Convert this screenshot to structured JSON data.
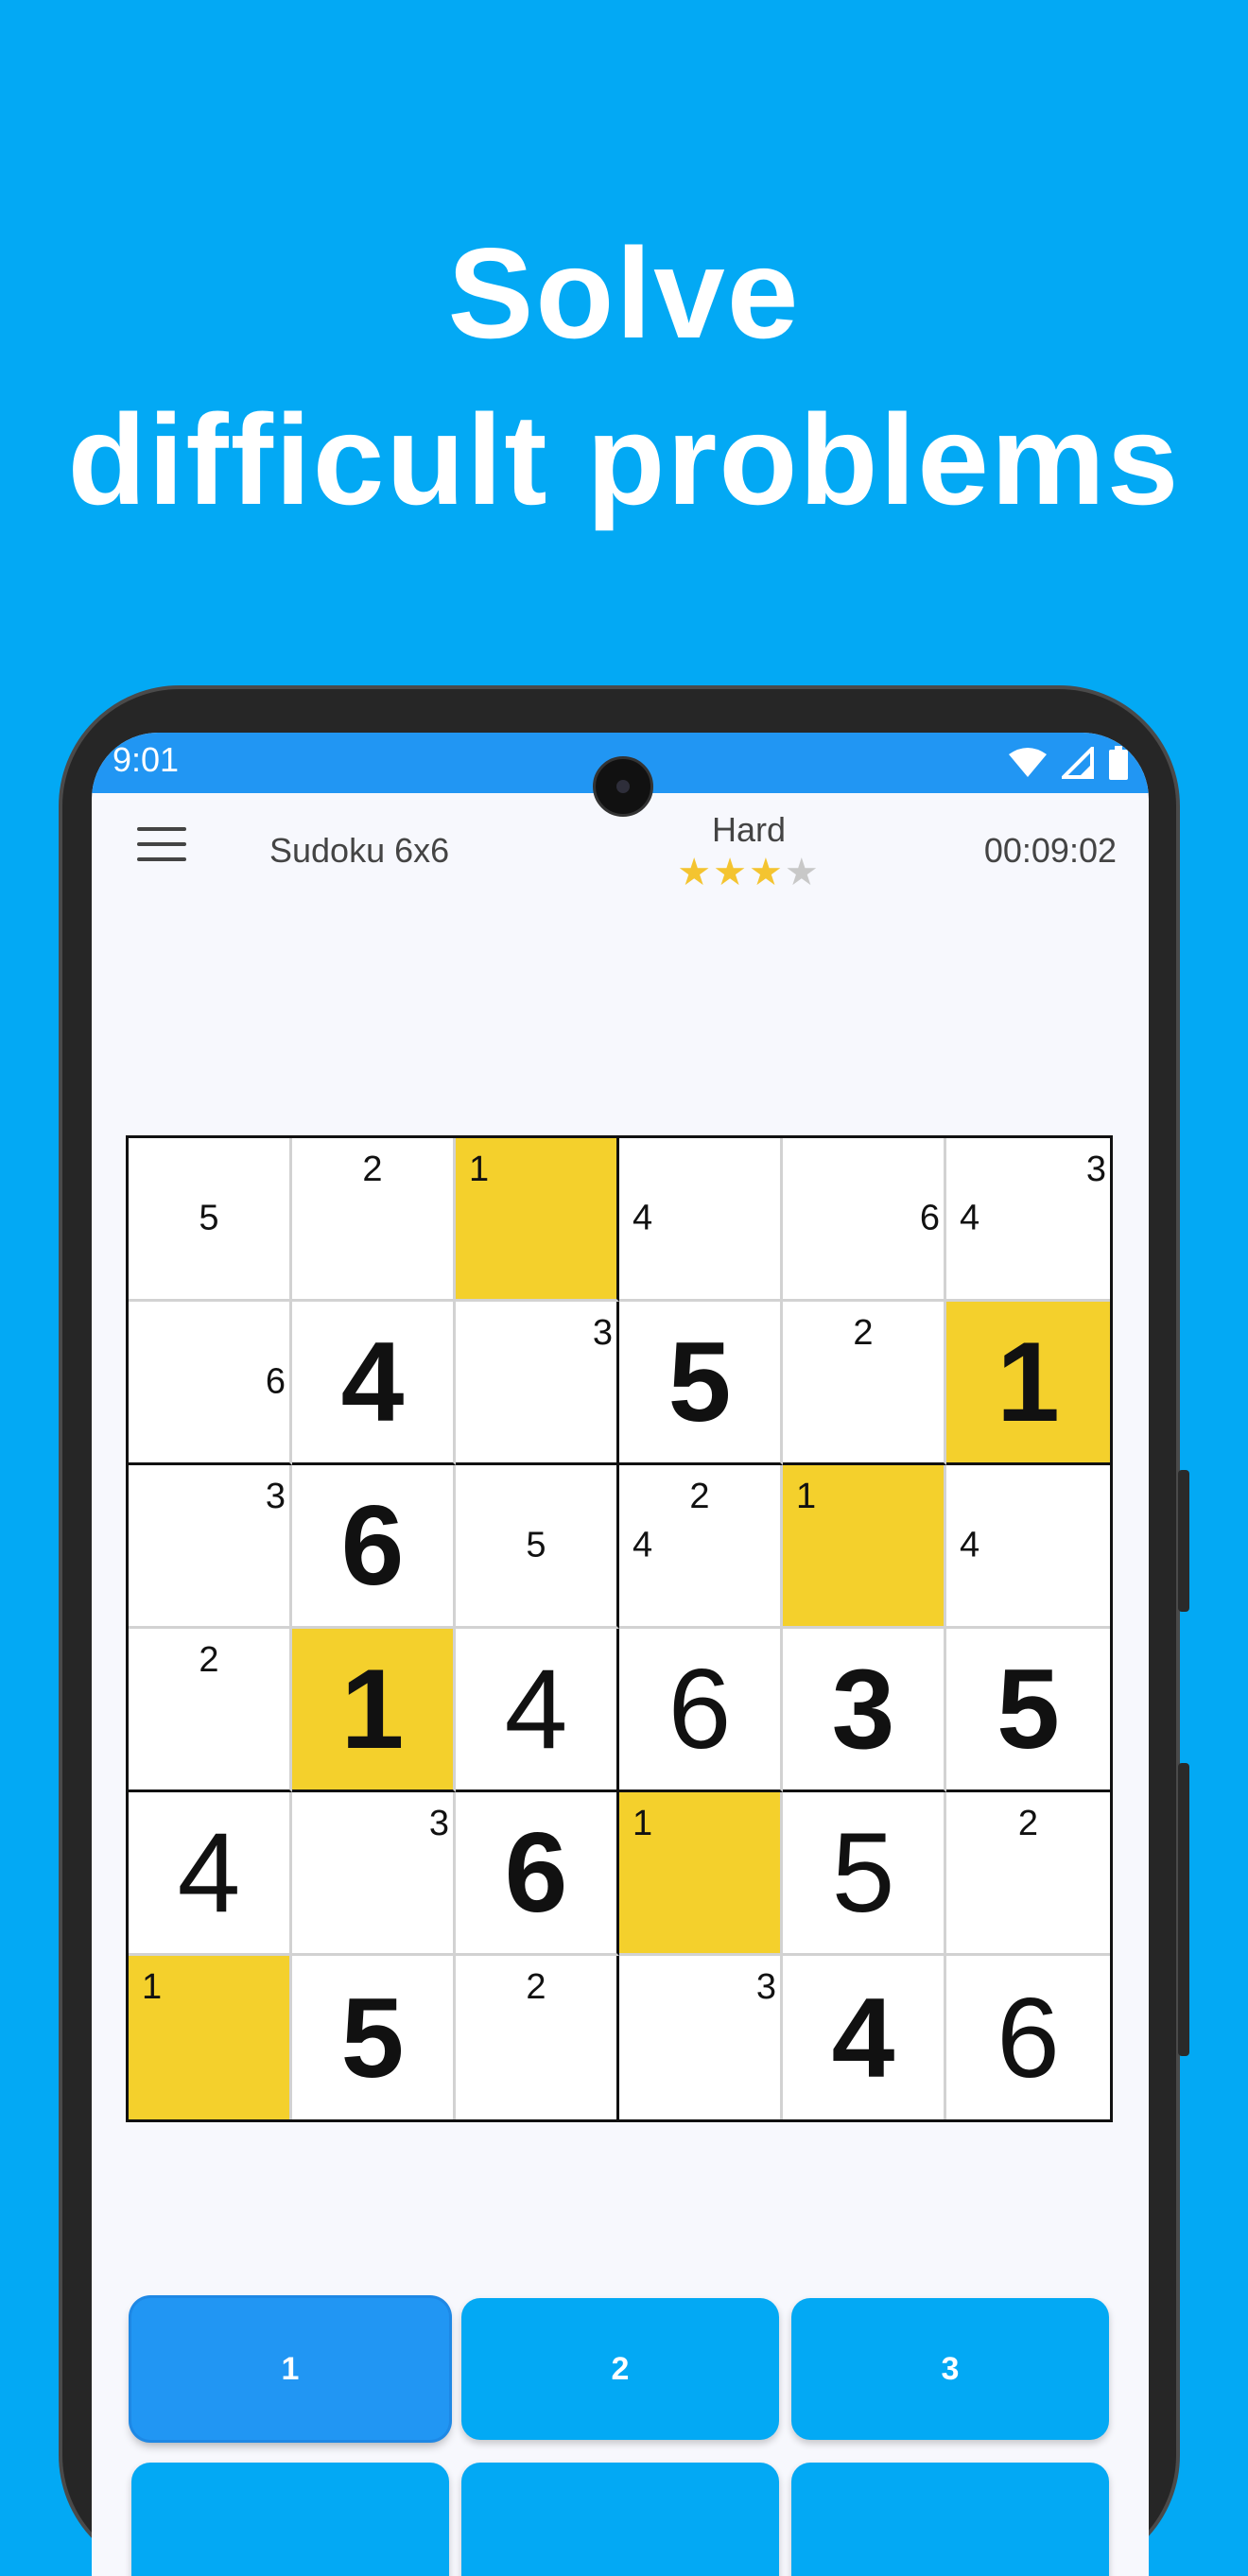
{
  "headline": {
    "line1": "Solve",
    "line2": "difficult problems"
  },
  "status_bar": {
    "time": "9:01",
    "icons": [
      "wifi-icon",
      "signal-icon",
      "battery-icon"
    ]
  },
  "app_bar": {
    "menu_icon": "menu-icon",
    "title": "Sudoku 6x6",
    "difficulty": "Hard",
    "stars_filled": 3,
    "stars_total": 4,
    "timer": "00:09:02"
  },
  "colors": {
    "background": "#03a9f4",
    "status_bar": "#2196f3",
    "highlight_cell": "#f4d02c",
    "star": "#f4c430",
    "key": "#03a9f4"
  },
  "board": {
    "size": 6,
    "rows": [
      [
        {
          "notes": [
            {
              "v": "5",
              "pos": "cc"
            }
          ]
        },
        {
          "notes": [
            {
              "v": "2",
              "pos": "tc"
            }
          ]
        },
        {
          "highlight": true,
          "notes": [
            {
              "v": "1",
              "pos": "tl"
            }
          ]
        },
        {
          "notes": [
            {
              "v": "4",
              "pos": "cl"
            }
          ]
        },
        {
          "notes": [
            {
              "v": "6",
              "pos": "cr"
            }
          ]
        },
        {
          "notes": [
            {
              "v": "3",
              "pos": "tr"
            },
            {
              "v": "4",
              "pos": "cl"
            }
          ]
        }
      ],
      [
        {
          "notes": [
            {
              "v": "6",
              "pos": "cr"
            }
          ]
        },
        {
          "value": "4",
          "bold": true
        },
        {
          "notes": [
            {
              "v": "3",
              "pos": "tr"
            }
          ]
        },
        {
          "value": "5",
          "bold": true
        },
        {
          "notes": [
            {
              "v": "2",
              "pos": "tc"
            }
          ]
        },
        {
          "highlight": true,
          "value": "1",
          "bold": true
        }
      ],
      [
        {
          "notes": [
            {
              "v": "3",
              "pos": "tr"
            }
          ]
        },
        {
          "value": "6",
          "bold": true
        },
        {
          "notes": [
            {
              "v": "5",
              "pos": "cc"
            }
          ]
        },
        {
          "notes": [
            {
              "v": "2",
              "pos": "tc"
            },
            {
              "v": "4",
              "pos": "cl"
            }
          ]
        },
        {
          "highlight": true,
          "notes": [
            {
              "v": "1",
              "pos": "tl"
            }
          ]
        },
        {
          "notes": [
            {
              "v": "4",
              "pos": "cl"
            }
          ]
        }
      ],
      [
        {
          "notes": [
            {
              "v": "2",
              "pos": "tc"
            }
          ]
        },
        {
          "highlight": true,
          "value": "1",
          "bold": true
        },
        {
          "value": "4",
          "bold": false
        },
        {
          "value": "6",
          "bold": false
        },
        {
          "value": "3",
          "bold": true
        },
        {
          "value": "5",
          "bold": true
        }
      ],
      [
        {
          "value": "4",
          "bold": false
        },
        {
          "notes": [
            {
              "v": "3",
              "pos": "tr"
            }
          ]
        },
        {
          "value": "6",
          "bold": true
        },
        {
          "highlight": true,
          "notes": [
            {
              "v": "1",
              "pos": "tl"
            }
          ]
        },
        {
          "value": "5",
          "bold": false
        },
        {
          "notes": [
            {
              "v": "2",
              "pos": "tc"
            }
          ]
        }
      ],
      [
        {
          "highlight": true,
          "notes": [
            {
              "v": "1",
              "pos": "tl"
            }
          ]
        },
        {
          "value": "5",
          "bold": true
        },
        {
          "notes": [
            {
              "v": "2",
              "pos": "tc"
            }
          ]
        },
        {
          "notes": [
            {
              "v": "3",
              "pos": "tr"
            }
          ]
        },
        {
          "value": "4",
          "bold": true
        },
        {
          "value": "6",
          "bold": false
        }
      ]
    ]
  },
  "keypad": {
    "keys": [
      {
        "label": "1",
        "selected": true
      },
      {
        "label": "2",
        "selected": false
      },
      {
        "label": "3",
        "selected": false
      }
    ]
  }
}
